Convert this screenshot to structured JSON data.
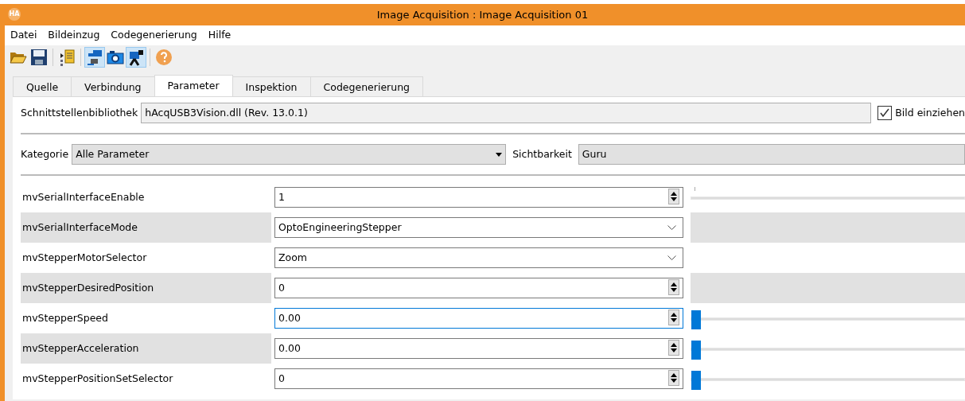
{
  "window": {
    "title": "Image Acquisition : Image Acquisition 01",
    "logo": "HA"
  },
  "menu": [
    "Datei",
    "Bildeinzug",
    "Codegenerierung",
    "Hilfe"
  ],
  "toolbar": [
    {
      "kind": "open",
      "pressed": false
    },
    {
      "kind": "save",
      "pressed": false
    },
    {
      "kind": "separator"
    },
    {
      "kind": "code",
      "pressed": false
    },
    {
      "kind": "separator"
    },
    {
      "kind": "connect",
      "pressed": true
    },
    {
      "kind": "camera",
      "pressed": false
    },
    {
      "kind": "video",
      "pressed": true
    },
    {
      "kind": "separator"
    },
    {
      "kind": "help",
      "pressed": false
    }
  ],
  "tabs": [
    {
      "label": "Quelle",
      "selected": false
    },
    {
      "label": "Verbindung",
      "selected": false
    },
    {
      "label": "Parameter",
      "selected": true
    },
    {
      "label": "Inspektion",
      "selected": false
    },
    {
      "label": "Codegenerierung",
      "selected": false
    }
  ],
  "interface": {
    "label": "Schnittstellenbibliothek",
    "value": "hAcqUSB3Vision.dll (Rev. 13.0.1)",
    "checkbox": {
      "label": "Bild einziehen",
      "checked": true
    }
  },
  "category": {
    "label": "Kategorie",
    "value": "Alle Parameter"
  },
  "visibility": {
    "label": "Sichtbarkeit",
    "value": "Guru"
  },
  "parameters": [
    {
      "name": "mvSerialInterfaceEnable",
      "kind": "spin",
      "value": "1",
      "focused": false,
      "slider": {
        "enabled": false
      }
    },
    {
      "name": "mvSerialInterfaceMode",
      "kind": "combo",
      "value": "OptoEngineeringStepper",
      "focused": false
    },
    {
      "name": "mvStepperMotorSelector",
      "kind": "combo",
      "value": "Zoom",
      "focused": false
    },
    {
      "name": "mvStepperDesiredPosition",
      "kind": "spin",
      "value": "0",
      "focused": false
    },
    {
      "name": "mvStepperSpeed",
      "kind": "spin",
      "value": "0.00",
      "focused": true,
      "slider": {
        "enabled": true,
        "level": 0
      }
    },
    {
      "name": "mvStepperAcceleration",
      "kind": "spin",
      "value": "0.00",
      "focused": false,
      "slider": {
        "enabled": true,
        "level": 0
      }
    },
    {
      "name": "mvStepperPositionSetSelector",
      "kind": "spin",
      "value": "0",
      "focused": false,
      "slider": {
        "enabled": true,
        "level": 0
      }
    }
  ]
}
